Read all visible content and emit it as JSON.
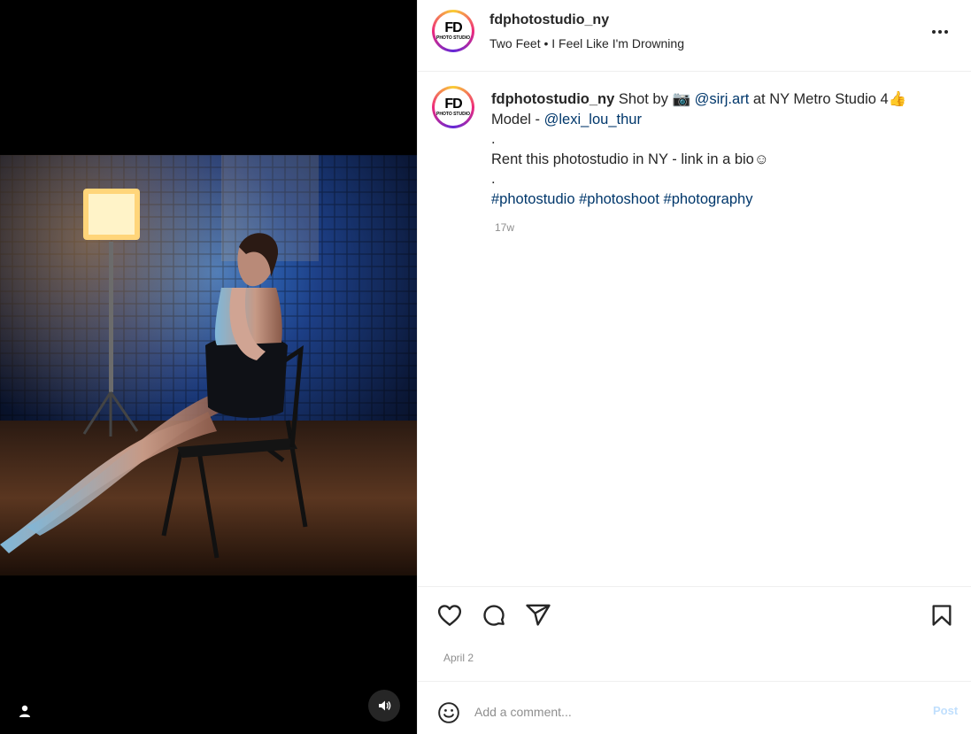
{
  "header": {
    "username": "fdphotostudio_ny",
    "audio": "Two Feet • I Feel Like I'm Drowning",
    "avatar_text": "FD",
    "avatar_sub": "PHOTO STUDIO"
  },
  "caption": {
    "username": "fdphotostudio_ny",
    "shot_by": "Shot by",
    "camera_emoji": "📷",
    "photographer": "@sirj.art",
    "studio": "at NY Metro Studio 4",
    "thumbs_emoji": "👍",
    "model_label": "Model -",
    "model": "@lexi_lou_thur",
    "dot1": ".",
    "rent": "Rent this photostudio in NY - link in a bio",
    "smile": "☺",
    "dot2": ".",
    "tags": [
      "#photostudio",
      "#photoshoot",
      "#photography"
    ],
    "age": "17w"
  },
  "actions": {
    "like_icon": "heart-icon",
    "comment_icon": "comment-icon",
    "share_icon": "share-icon",
    "save_icon": "bookmark-icon",
    "date": "April 2"
  },
  "comment": {
    "placeholder": "Add a comment...",
    "post_label": "Post"
  },
  "colors": {
    "link": "#00376b",
    "muted": "#8e8e8e",
    "post_disabled": "#c0dffd"
  }
}
